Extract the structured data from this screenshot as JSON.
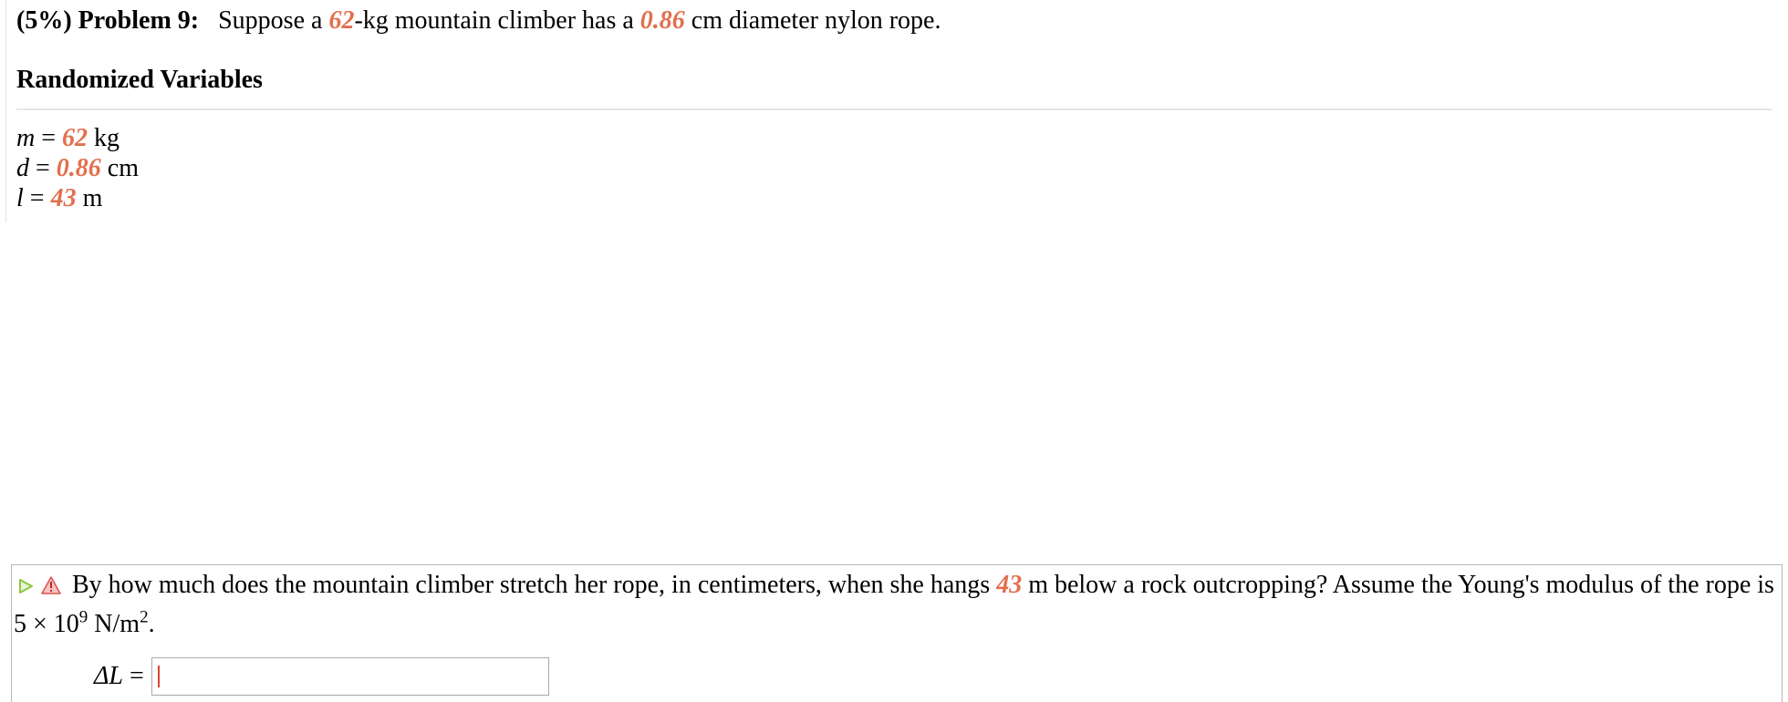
{
  "problem": {
    "weight": "(5%)",
    "label": "Problem 9:",
    "text_parts": [
      "Suppose a ",
      "62",
      "-kg mountain climber has a ",
      "0.86",
      " cm diameter nylon rope."
    ]
  },
  "randomized_variables": {
    "title": "Randomized Variables",
    "items": [
      {
        "symbol": "m",
        "eq": " = ",
        "value": "62",
        "unit": " kg"
      },
      {
        "symbol": "d",
        "eq": " = ",
        "value": "0.86",
        "unit": " cm"
      },
      {
        "symbol": "l",
        "eq": " = ",
        "value": "43",
        "unit": " m"
      }
    ]
  },
  "question": {
    "icons": [
      "play-icon",
      "warning-icon"
    ],
    "text_before": "By how much does the mountain climber stretch her rope, in centimeters, when she hangs ",
    "value": "43",
    "text_after": " m below a rock outcropping? Assume the Young's modulus of the rope is 5 × 10",
    "exponent": "9",
    "unit_base": " N/m",
    "unit_exponent": "2",
    "end": ".",
    "answer_label": "ΔL",
    "answer_eq": " = ",
    "answer_value": ""
  },
  "colors": {
    "variable": "#e2704e",
    "play_icon": "#8dc63f",
    "warning_icon": "#d9534f"
  }
}
